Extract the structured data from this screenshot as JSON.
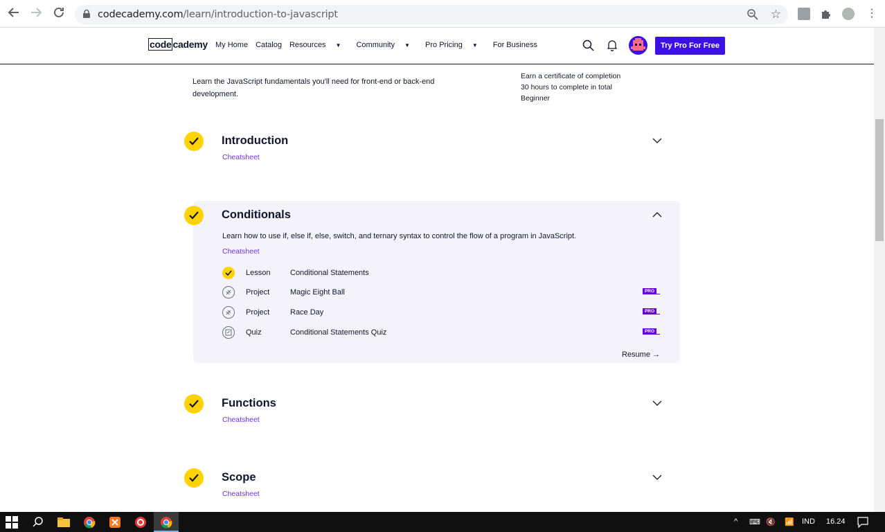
{
  "browser": {
    "url_host": "codecademy.com",
    "url_path": "/learn/introduction-to-javascript"
  },
  "header": {
    "logo_part1": "code",
    "logo_part2": "cademy",
    "nav": [
      "My Home",
      "Catalog",
      "Resources",
      "Community",
      "Pro Pricing",
      "For Business"
    ],
    "cta": "Try Pro For Free"
  },
  "course": {
    "description": "Learn the JavaScript fundamentals you'll need for front-end or back-end development.",
    "meta": [
      "Earn a certificate of completion",
      "30 hours to complete in total",
      "Beginner"
    ]
  },
  "modules": [
    {
      "title": "Introduction",
      "cheatsheet": "Cheatsheet",
      "completed": true,
      "expanded": false
    },
    {
      "title": "Conditionals",
      "cheatsheet": "Cheatsheet",
      "completed": true,
      "expanded": true,
      "description": "Learn how to use if, else if, else, switch, and ternary syntax to control the flow of a program in JavaScript.",
      "items": [
        {
          "type": "Lesson",
          "name": "Conditional Statements",
          "completed": true,
          "pro": false
        },
        {
          "type": "Project",
          "name": "Magic Eight Ball",
          "completed": false,
          "pro": true
        },
        {
          "type": "Project",
          "name": "Race Day",
          "completed": false,
          "pro": true
        },
        {
          "type": "Quiz",
          "name": "Conditional Statements Quiz",
          "completed": false,
          "pro": true
        }
      ],
      "resume": "Resume"
    },
    {
      "title": "Functions",
      "cheatsheet": "Cheatsheet",
      "completed": true,
      "expanded": false
    },
    {
      "title": "Scope",
      "cheatsheet": "Cheatsheet",
      "completed": true,
      "expanded": false
    }
  ],
  "pro_badge": "PRO",
  "taskbar": {
    "language": "IND",
    "time": "16.24"
  },
  "colors": {
    "accent": "#3a10e5",
    "check": "#ffd300",
    "link": "#6f2fe8",
    "pro": "#6400e4"
  }
}
